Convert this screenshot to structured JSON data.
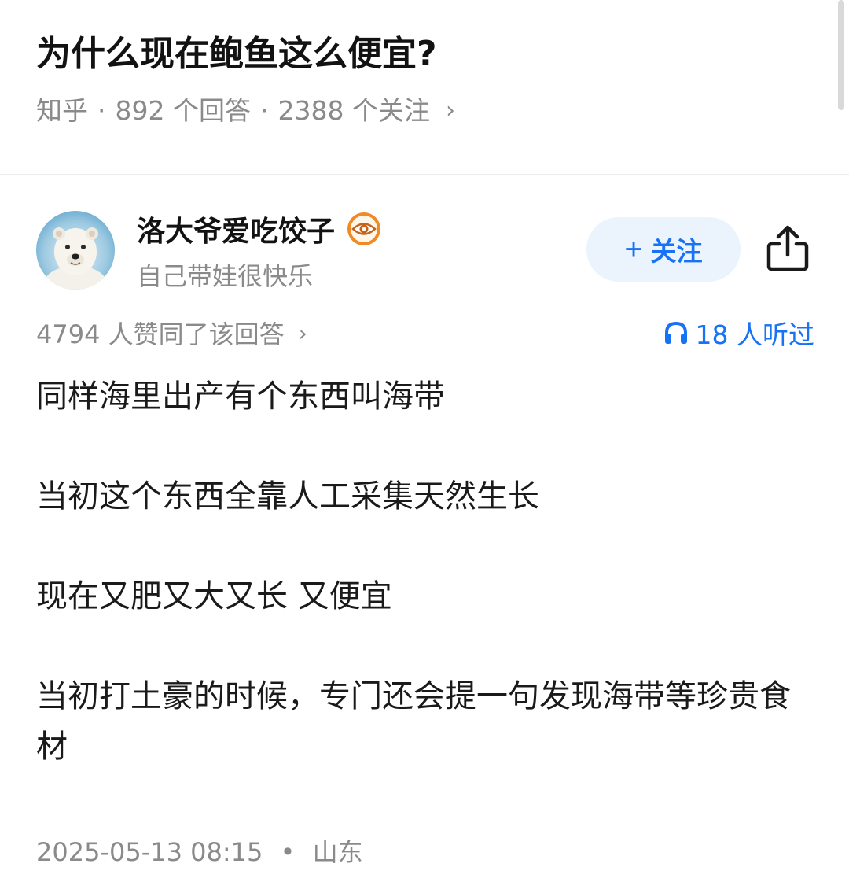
{
  "question": {
    "title": "为什么现在鲍鱼这么便宜?",
    "source": "知乎",
    "answers": "892 个回答",
    "followers": "2388 个关注",
    "separator": "·",
    "chevron": "›"
  },
  "author": {
    "name": "洛大爷爱吃饺子",
    "bio": "自己带娃很快乐",
    "badge_icon": "eye-badge-icon",
    "avatar": "polar-bear-avatar"
  },
  "actions": {
    "follow_plus": "+",
    "follow_label": "关注",
    "share_icon": "share-icon"
  },
  "stats": {
    "votes": "4794 人赞同了该回答",
    "votes_chevron": "›",
    "listened": "18 人听过"
  },
  "content": {
    "paragraphs": [
      "同样海里出产有个东西叫海带",
      "当初这个东西全靠人工采集天然生长",
      "现在又肥又大又长 又便宜",
      "当初打土豪的时候，专门还会提一句发现海带等珍贵食材"
    ]
  },
  "footer": {
    "date": "2025-05-13 08:15",
    "separator": "•",
    "location": "山东"
  },
  "colors": {
    "accent": "#1772f6",
    "follow_bg": "#ebf3fd",
    "muted": "#8a8a8a",
    "text": "#1a1a1a",
    "badge_orange": "#f08a24"
  }
}
